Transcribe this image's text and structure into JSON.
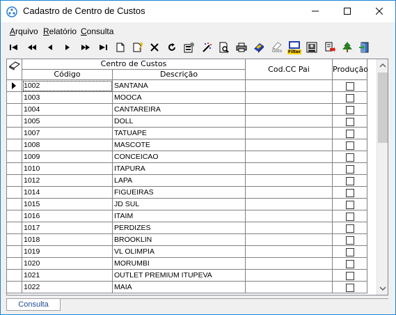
{
  "window": {
    "title": "Cadastro de Centro de Custos"
  },
  "menu": [
    {
      "label": "Arquivo",
      "accel": "A",
      "rest": "rquivo"
    },
    {
      "label": "Relatório",
      "accel": "R",
      "rest": "elatório"
    },
    {
      "label": "Consulta",
      "accel": "C",
      "rest": "onsulta"
    }
  ],
  "toolbar": {
    "buttons": [
      "first-record",
      "prior-record",
      "previous",
      "next",
      "next-record",
      "last-record",
      "new",
      "edit",
      "delete",
      "refresh",
      "properties",
      "magic",
      "preview",
      "print",
      "export",
      "goto",
      "filter",
      "image",
      "report-export",
      "tree",
      "exit"
    ],
    "goto_label": "Goto",
    "filter_label": "Filter"
  },
  "grid": {
    "group_header": "Centro de Custos",
    "columns": {
      "codigo": "Código",
      "descricao": "Descrição",
      "cod_cc_pai": "Cod.CC Pai",
      "producao": "Produção"
    },
    "rows": [
      {
        "codigo": "1002",
        "descricao": "SANTANA",
        "cod_cc_pai": "",
        "producao": false
      },
      {
        "codigo": "1003",
        "descricao": "MOOCA",
        "cod_cc_pai": "",
        "producao": false
      },
      {
        "codigo": "1004",
        "descricao": "CANTAREIRA",
        "cod_cc_pai": "",
        "producao": false
      },
      {
        "codigo": "1005",
        "descricao": "DOLL",
        "cod_cc_pai": "",
        "producao": false
      },
      {
        "codigo": "1007",
        "descricao": "TATUAPE",
        "cod_cc_pai": "",
        "producao": false
      },
      {
        "codigo": "1008",
        "descricao": "MASCOTE",
        "cod_cc_pai": "",
        "producao": false
      },
      {
        "codigo": "1009",
        "descricao": "CONCEICAO",
        "cod_cc_pai": "",
        "producao": false
      },
      {
        "codigo": "1010",
        "descricao": "ITAPURA",
        "cod_cc_pai": "",
        "producao": false
      },
      {
        "codigo": "1012",
        "descricao": "LAPA",
        "cod_cc_pai": "",
        "producao": false
      },
      {
        "codigo": "1014",
        "descricao": "FIGUEIRAS",
        "cod_cc_pai": "",
        "producao": false
      },
      {
        "codigo": "1015",
        "descricao": "JD SUL",
        "cod_cc_pai": "",
        "producao": false
      },
      {
        "codigo": "1016",
        "descricao": "ITAIM",
        "cod_cc_pai": "",
        "producao": false
      },
      {
        "codigo": "1017",
        "descricao": "PERDIZES",
        "cod_cc_pai": "",
        "producao": false
      },
      {
        "codigo": "1018",
        "descricao": "BROOKLIN",
        "cod_cc_pai": "",
        "producao": false
      },
      {
        "codigo": "1019",
        "descricao": "VL OLIMPIA",
        "cod_cc_pai": "",
        "producao": false
      },
      {
        "codigo": "1020",
        "descricao": "MORUMBI",
        "cod_cc_pai": "",
        "producao": false
      },
      {
        "codigo": "1021",
        "descricao": "OUTLET PREMIUM ITUPEVA",
        "cod_cc_pai": "",
        "producao": false
      },
      {
        "codigo": "1022",
        "descricao": "MAIA",
        "cod_cc_pai": "",
        "producao": false
      }
    ]
  },
  "tabs": [
    {
      "label": "Consulta"
    }
  ],
  "colors": {
    "accent": "#1883d7",
    "tab_text": "#1c4a93"
  }
}
